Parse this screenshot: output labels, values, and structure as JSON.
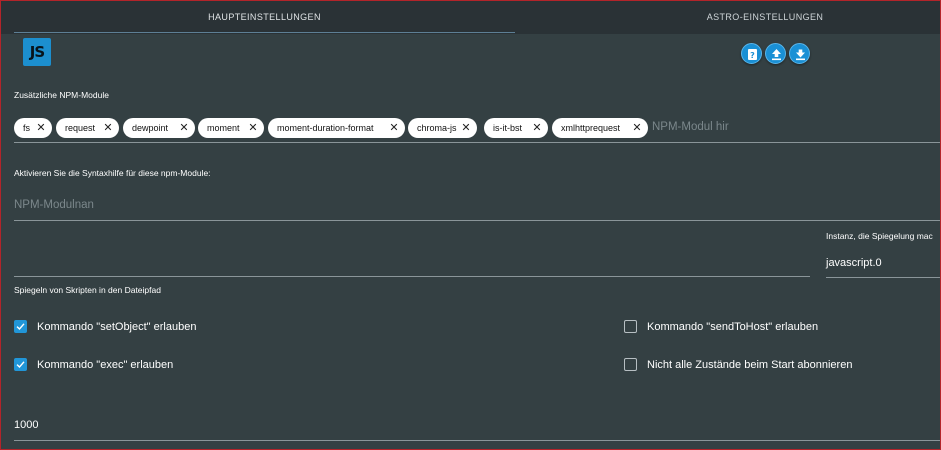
{
  "tabs": {
    "main": "HAUPTEINSTELLUNGEN",
    "astro": "ASTRO-EINSTELLUNGEN"
  },
  "logo": {
    "text": "JS",
    "color": "#1c8fcf"
  },
  "actions": [
    {
      "icon": "help-icon"
    },
    {
      "icon": "upload-icon"
    },
    {
      "icon": "download-icon"
    }
  ],
  "npm": {
    "label": "Zusätzliche NPM-Module",
    "modules": [
      "fs",
      "request",
      "dewpoint",
      "moment",
      "moment-duration-format",
      "chroma-js",
      "is-it-bst",
      "xmlhttprequest"
    ],
    "placeholder": "NPM-Modul hir"
  },
  "syntax": {
    "label": "Aktivieren Sie die Syntaxhilfe für diese npm-Module:",
    "placeholder": "NPM-Modulnan"
  },
  "mirror": {
    "label": "Spiegeln von Skripten in den Dateipfad",
    "instance_label": "Instanz, die Spiegelung mac",
    "instance_value": "javascript.0"
  },
  "options": [
    {
      "label": "Kommando \"setObject\" erlauben",
      "checked": true
    },
    {
      "label": "Kommando \"sendToHost\" erlauben",
      "checked": false
    },
    {
      "label": "Kommando \"exec\" erlauben",
      "checked": true
    },
    {
      "label": "Nicht alle Zustände beim Start abonnieren",
      "checked": false
    }
  ],
  "number_field": {
    "value": "1000"
  },
  "colors": {
    "accent": "#1a90d5",
    "background": "#344043",
    "header": "#2a3236"
  }
}
